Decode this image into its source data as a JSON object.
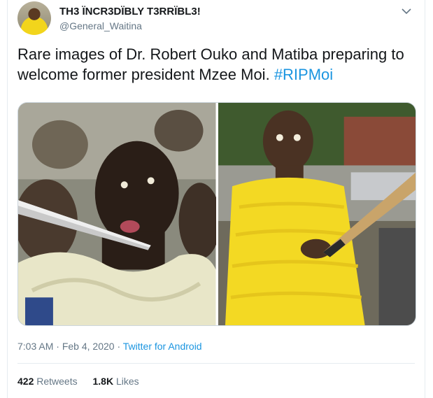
{
  "tweet": {
    "author_name": "TH3 ÏNCR3DÏBLY T3RRÏBL3!",
    "author_handle": "@General_Waitina",
    "text": "Rare images of Dr. Robert Ouko and Matiba preparing to welcome former president Mzee Moi.",
    "hashtag": "#RIPMoi",
    "time": "7:03 AM",
    "date": "Feb 4, 2020",
    "source": "Twitter for Android",
    "retweets_count": "422",
    "retweets_label": "Retweets",
    "likes_count": "1.8K",
    "likes_label": "Likes"
  },
  "icons": {
    "menu": "chevron-down-icon"
  },
  "colors": {
    "link": "#1b95e0",
    "secondary_text": "#657786",
    "primary_text": "#14171a",
    "border": "#e6ecf0"
  }
}
